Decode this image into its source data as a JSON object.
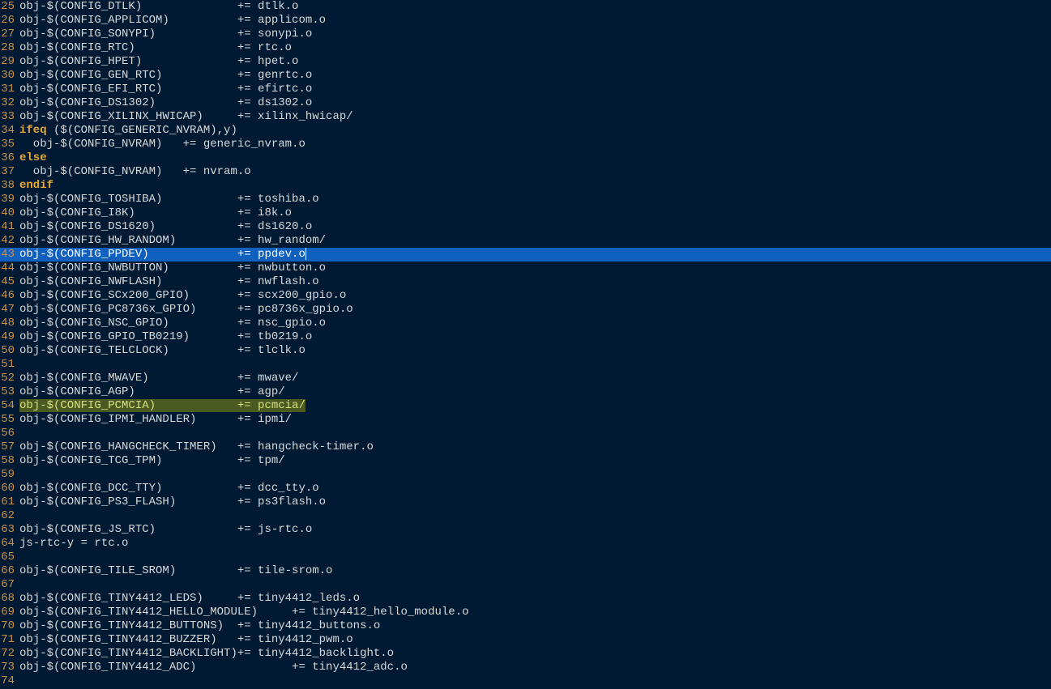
{
  "lines": [
    {
      "n": 25,
      "type": "plain",
      "text": "obj-$(CONFIG_DTLK)\t\t+= dtlk.o"
    },
    {
      "n": 26,
      "type": "plain",
      "text": "obj-$(CONFIG_APPLICOM)\t\t+= applicom.o"
    },
    {
      "n": 27,
      "type": "plain",
      "text": "obj-$(CONFIG_SONYPI)\t\t+= sonypi.o"
    },
    {
      "n": 28,
      "type": "plain",
      "text": "obj-$(CONFIG_RTC)\t\t+= rtc.o"
    },
    {
      "n": 29,
      "type": "plain",
      "text": "obj-$(CONFIG_HPET)\t\t+= hpet.o"
    },
    {
      "n": 30,
      "type": "plain",
      "text": "obj-$(CONFIG_GEN_RTC)\t\t+= genrtc.o"
    },
    {
      "n": 31,
      "type": "plain",
      "text": "obj-$(CONFIG_EFI_RTC)\t\t+= efirtc.o"
    },
    {
      "n": 32,
      "type": "plain",
      "text": "obj-$(CONFIG_DS1302)\t\t+= ds1302.o"
    },
    {
      "n": 33,
      "type": "plain",
      "text": "obj-$(CONFIG_XILINX_HWICAP)\t+= xilinx_hwicap/"
    },
    {
      "n": 34,
      "type": "kw",
      "kw": "ifeq",
      "rest": " ($(CONFIG_GENERIC_NVRAM),y)"
    },
    {
      "n": 35,
      "type": "plain",
      "text": "  obj-$(CONFIG_NVRAM)\t+= generic_nvram.o"
    },
    {
      "n": 36,
      "type": "kw",
      "kw": "else",
      "rest": ""
    },
    {
      "n": 37,
      "type": "plain",
      "text": "  obj-$(CONFIG_NVRAM)\t+= nvram.o"
    },
    {
      "n": 38,
      "type": "kw",
      "kw": "endif",
      "rest": ""
    },
    {
      "n": 39,
      "type": "plain",
      "text": "obj-$(CONFIG_TOSHIBA)\t\t+= toshiba.o"
    },
    {
      "n": 40,
      "type": "plain",
      "text": "obj-$(CONFIG_I8K)\t\t+= i8k.o"
    },
    {
      "n": 41,
      "type": "plain",
      "text": "obj-$(CONFIG_DS1620)\t\t+= ds1620.o"
    },
    {
      "n": 42,
      "type": "plain",
      "text": "obj-$(CONFIG_HW_RANDOM)\t\t+= hw_random/"
    },
    {
      "n": 43,
      "type": "cursor",
      "text": "obj-$(CONFIG_PPDEV)\t\t+= ppdev.o"
    },
    {
      "n": 44,
      "type": "plain",
      "text": "obj-$(CONFIG_NWBUTTON)\t\t+= nwbutton.o"
    },
    {
      "n": 45,
      "type": "plain",
      "text": "obj-$(CONFIG_NWFLASH)\t\t+= nwflash.o"
    },
    {
      "n": 46,
      "type": "plain",
      "text": "obj-$(CONFIG_SCx200_GPIO)\t+= scx200_gpio.o"
    },
    {
      "n": 47,
      "type": "plain",
      "text": "obj-$(CONFIG_PC8736x_GPIO)\t+= pc8736x_gpio.o"
    },
    {
      "n": 48,
      "type": "plain",
      "text": "obj-$(CONFIG_NSC_GPIO)\t\t+= nsc_gpio.o"
    },
    {
      "n": 49,
      "type": "plain",
      "text": "obj-$(CONFIG_GPIO_TB0219)\t+= tb0219.o"
    },
    {
      "n": 50,
      "type": "plain",
      "text": "obj-$(CONFIG_TELCLOCK)\t\t+= tlclk.o"
    },
    {
      "n": 51,
      "type": "plain",
      "text": ""
    },
    {
      "n": 52,
      "type": "plain",
      "text": "obj-$(CONFIG_MWAVE)\t\t+= mwave/"
    },
    {
      "n": 53,
      "type": "plain",
      "text": "obj-$(CONFIG_AGP)\t\t+= agp/"
    },
    {
      "n": 54,
      "type": "modified",
      "text": "obj-$(CONFIG_PCMCIA)\t\t+= pcmcia/"
    },
    {
      "n": 55,
      "type": "plain",
      "text": "obj-$(CONFIG_IPMI_HANDLER)\t+= ipmi/"
    },
    {
      "n": 56,
      "type": "plain",
      "text": ""
    },
    {
      "n": 57,
      "type": "plain",
      "text": "obj-$(CONFIG_HANGCHECK_TIMER)\t+= hangcheck-timer.o"
    },
    {
      "n": 58,
      "type": "plain",
      "text": "obj-$(CONFIG_TCG_TPM)\t\t+= tpm/"
    },
    {
      "n": 59,
      "type": "plain",
      "text": ""
    },
    {
      "n": 60,
      "type": "plain",
      "text": "obj-$(CONFIG_DCC_TTY)\t\t+= dcc_tty.o"
    },
    {
      "n": 61,
      "type": "plain",
      "text": "obj-$(CONFIG_PS3_FLASH)\t\t+= ps3flash.o"
    },
    {
      "n": 62,
      "type": "plain",
      "text": ""
    },
    {
      "n": 63,
      "type": "plain",
      "text": "obj-$(CONFIG_JS_RTC)\t\t+= js-rtc.o"
    },
    {
      "n": 64,
      "type": "plain",
      "text": "js-rtc-y = rtc.o"
    },
    {
      "n": 65,
      "type": "plain",
      "text": ""
    },
    {
      "n": 66,
      "type": "plain",
      "text": "obj-$(CONFIG_TILE_SROM)\t\t+= tile-srom.o"
    },
    {
      "n": 67,
      "type": "plain",
      "text": ""
    },
    {
      "n": 68,
      "type": "plain",
      "text": "obj-$(CONFIG_TINY4412_LEDS)\t+= tiny4412_leds.o"
    },
    {
      "n": 69,
      "type": "plain",
      "text": "obj-$(CONFIG_TINY4412_HELLO_MODULE)\t+= tiny4412_hello_module.o"
    },
    {
      "n": 70,
      "type": "plain",
      "text": "obj-$(CONFIG_TINY4412_BUTTONS)\t+= tiny4412_buttons.o"
    },
    {
      "n": 71,
      "type": "plain",
      "text": "obj-$(CONFIG_TINY4412_BUZZER)\t+= tiny4412_pwm.o"
    },
    {
      "n": 72,
      "type": "plain",
      "text": "obj-$(CONFIG_TINY4412_BACKLIGHT)+= tiny4412_backlight.o"
    },
    {
      "n": 73,
      "type": "plain",
      "text": "obj-$(CONFIG_TINY4412_ADC)\t\t+= tiny4412_adc.o"
    },
    {
      "n": 74,
      "type": "plain",
      "text": ""
    }
  ]
}
